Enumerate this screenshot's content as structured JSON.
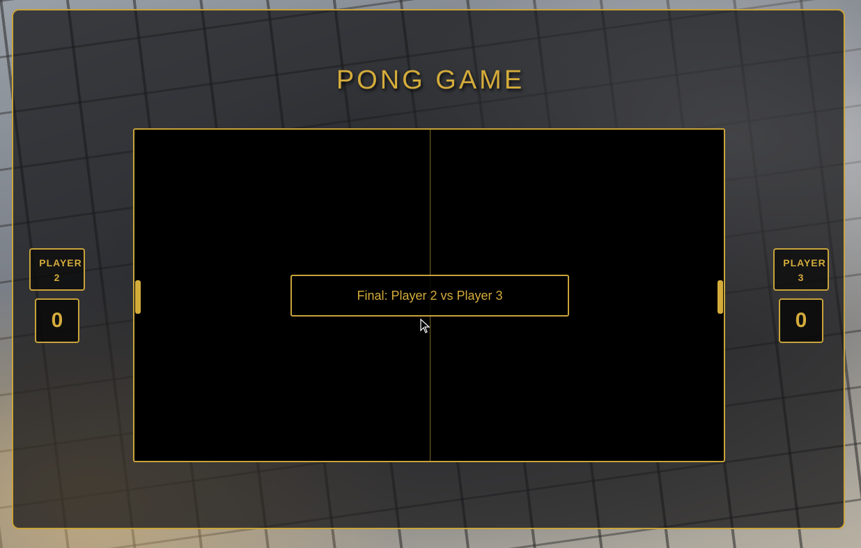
{
  "title": "PONG GAME",
  "message": "Final: Player 2 vs Player 3",
  "left_player": {
    "label_line1": "PLAYER",
    "label_line2": "2",
    "score": "0"
  },
  "right_player": {
    "label_line1": "PLAYER",
    "label_line2": "3",
    "score": "0"
  },
  "colors": {
    "accent": "#d4ac3b",
    "court": "#000000"
  }
}
